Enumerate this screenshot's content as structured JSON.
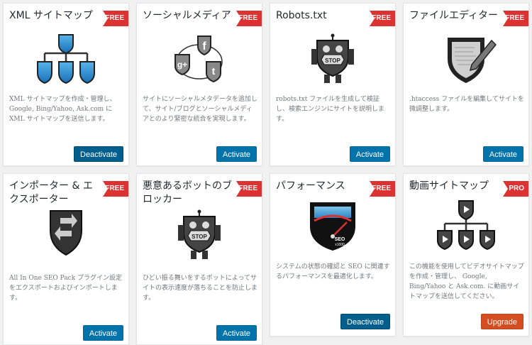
{
  "cards": [
    {
      "title": "XML サイトマップ",
      "badge": "FREE",
      "desc": "XML サイトマップを作成・管理し、Google, Bing/Yahoo, Ask.com に XML サイトマップを送信します。",
      "button": "Deactivate"
    },
    {
      "title": "ソーシャルメディア",
      "badge": "FREE",
      "desc": "サイトにソーシャルメタデータを追加して、サイト/ブログとソーシャルメディアとのより緊密な統合を実現します。",
      "button": "Activate"
    },
    {
      "title": "Robots.txt",
      "badge": "FREE",
      "desc": "robots.txt ファイルを生成して検証し、検索エンジンにサイトを説明します。",
      "button": "Activate"
    },
    {
      "title": "ファイルエディター",
      "badge": "FREE",
      "desc": ".htaccess ファイルを編集してサイトを微調整します。",
      "button": "Activate"
    },
    {
      "title": "インポーター & エクスポーター",
      "badge": "FREE",
      "desc": "All In One SEO Pack プラグイン設定をエクスポートおよびインポートします。",
      "button": "Activate"
    },
    {
      "title": "悪意あるボットのブロッカー",
      "badge": "FREE",
      "desc": "ひどい振る舞いをするボットによってサイトの表示速度が落ちることを防止します。",
      "button": "Activate"
    },
    {
      "title": "パフォーマンス",
      "badge": "FREE",
      "desc": "システムの状態の確認と SEO に関連するパフォーマンスを最適化します。",
      "button": "Deactivate"
    },
    {
      "title": "動画サイトマップ",
      "badge": "PRO",
      "desc": "この機能を使用してビデオサイトマップを作成・管理し、 Google, Bing/Yahoo と Ask.com. に動画サイトマップを送信してください。",
      "button": "Upgrade"
    }
  ],
  "art": {
    "gauge_label": "SEO",
    "gauge_sub": "x1000",
    "stop_label": "STOP"
  },
  "colors": {
    "badge_free": "#dc3232",
    "badge_pro": "#dc3232",
    "button": "#0073aa",
    "button_upgrade": "#d54e21"
  }
}
